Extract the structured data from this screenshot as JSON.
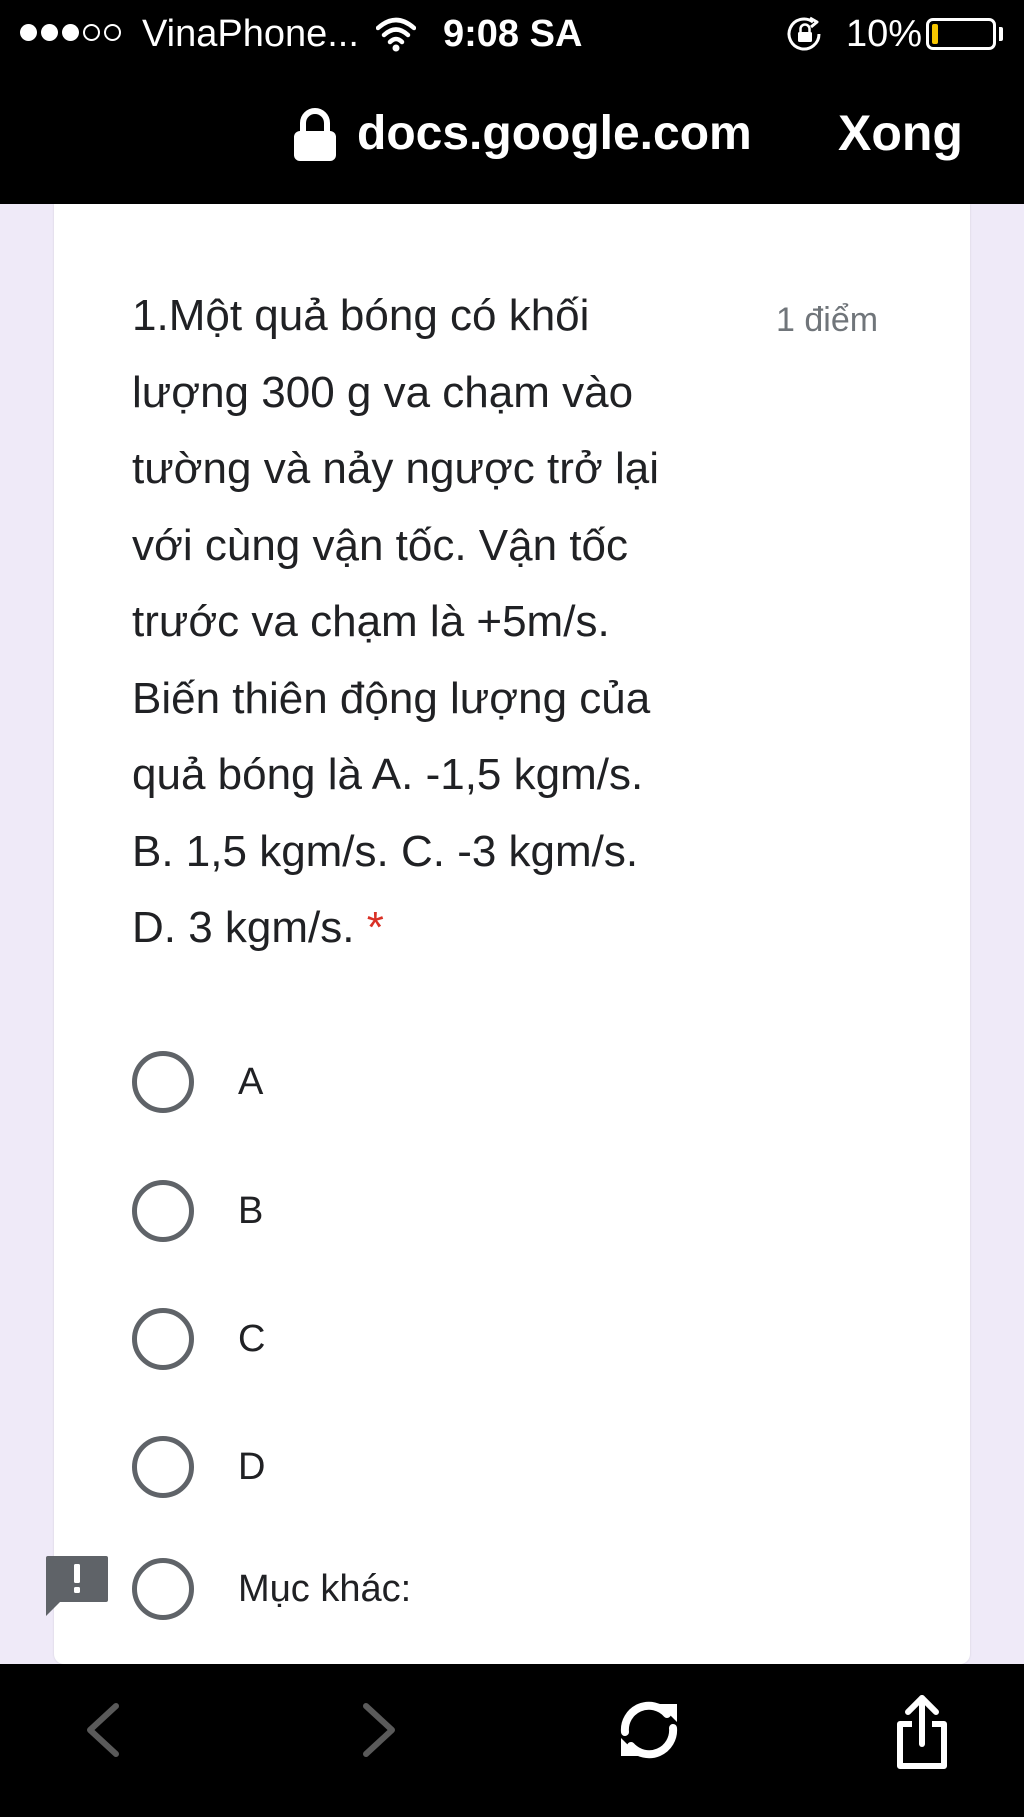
{
  "status_bar": {
    "carrier": "VinaPhone...",
    "time": "9:08 SA",
    "battery_percent": "10%",
    "battery_level": 0.1,
    "signal_bars_filled": 3,
    "signal_bars_total": 5,
    "icons": [
      "wifi-icon",
      "orientation-lock-icon",
      "battery-icon"
    ]
  },
  "browser": {
    "domain": "docs.google.com",
    "done_label": "Xong",
    "icons": [
      "lock-icon",
      "back-arrow-icon",
      "forward-arrow-icon",
      "reload-icon",
      "share-icon"
    ]
  },
  "question": {
    "text": "1.Một quả bóng có khối lượng 300 g va chạm vào tường và nảy ngược trở lại với cùng vận tốc. Vận tốc trước va chạm là +5m/s. Biến thiên động lượng của quả bóng là A. -1,5 kgm/s. B. 1,5 kgm/s. C. -3 kgm/s. D. 3 kgm/s.",
    "required_mark": "*",
    "points": "1 điểm",
    "options": [
      "A",
      "B",
      "C",
      "D",
      "Mục khác:"
    ]
  },
  "colors": {
    "page_background": "#efeaf8",
    "chrome_background": "#000000",
    "required": "#d93025",
    "radio": "#5f6368",
    "battery_low": "#f7c600",
    "feedback": "#5f6368"
  }
}
